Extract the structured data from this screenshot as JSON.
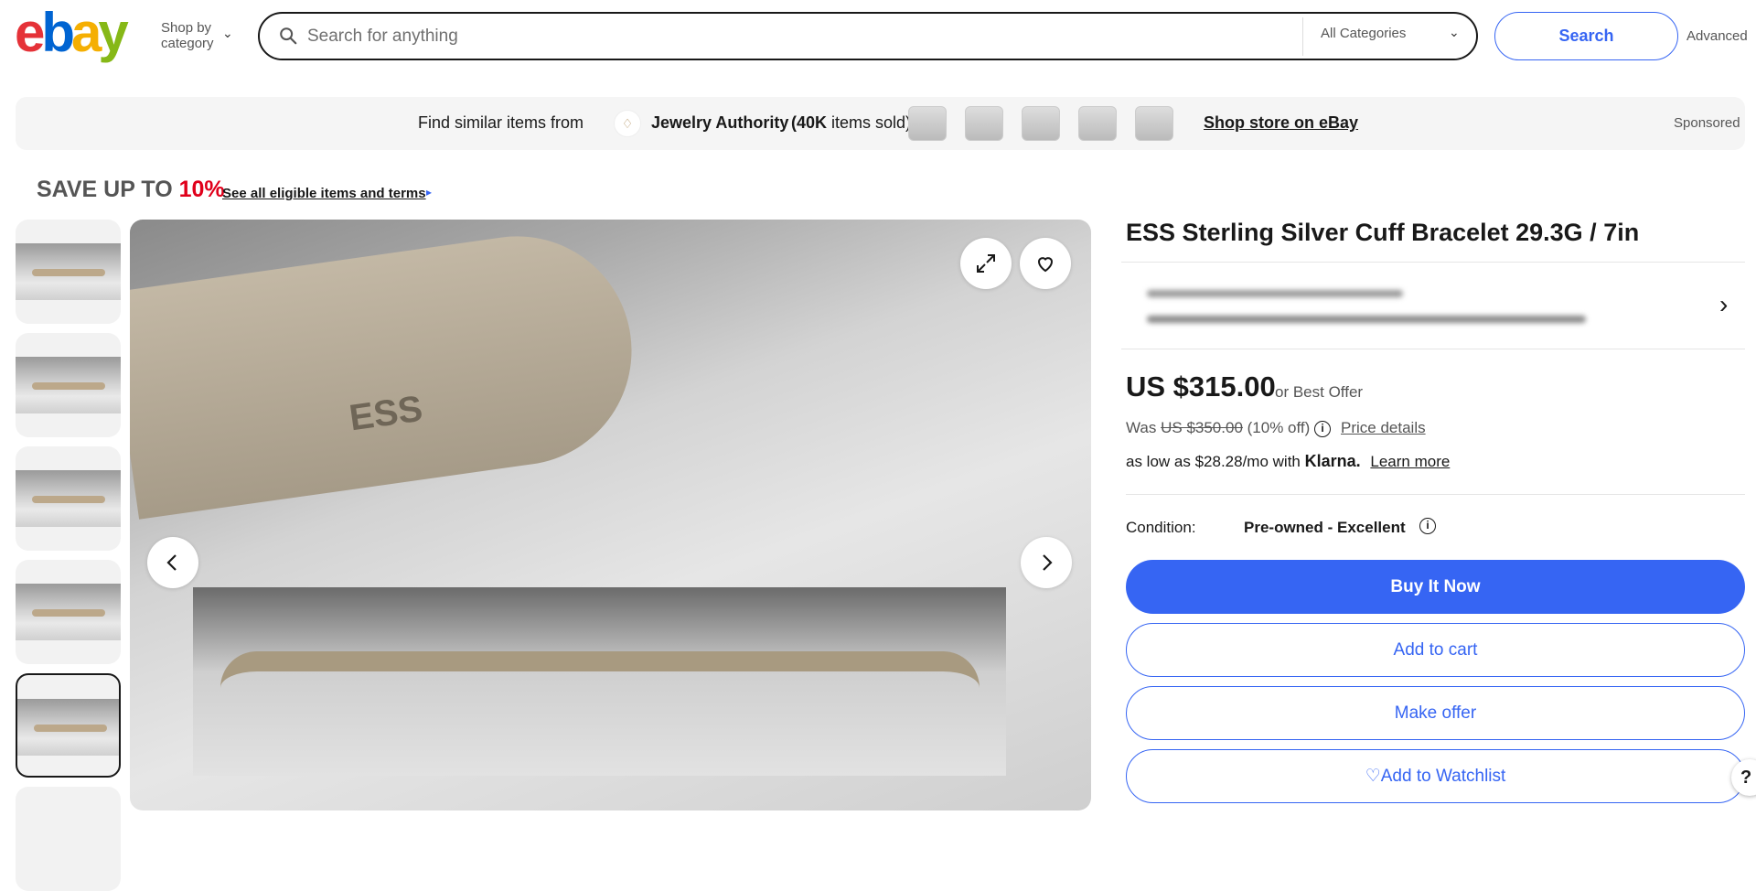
{
  "header": {
    "logo_letters": [
      "e",
      "b",
      "a",
      "y"
    ],
    "shop_by_line1": "Shop by",
    "shop_by_line2": "category",
    "search_placeholder": "Search for anything",
    "category_select": "All Categories",
    "search_button": "Search",
    "advanced_link": "Advanced"
  },
  "promo": {
    "find_text": "Find similar items from",
    "store_name": "Jewelry Authority",
    "sold_count": "(40K",
    "sold_suffix": "items sold)",
    "shop_store_link": "Shop store on eBay",
    "sponsored": "Sponsored"
  },
  "savings": {
    "prefix": "SAVE UP TO ",
    "percent": "10%",
    "link": "See all eligible items and terms"
  },
  "item": {
    "title": "ESS Sterling Silver Cuff Bracelet 29.3G / 7in",
    "price": "US $315.00",
    "best_offer": "or Best Offer",
    "was_label": "Was",
    "was_price": "US $350.00",
    "discount": "(10% off)",
    "price_details": "Price details",
    "klarna_text": "as low as $28.28/mo with",
    "klarna_brand": "Klarna.",
    "klarna_learn_more": "Learn more",
    "condition_label": "Condition:",
    "condition_value": "Pre-owned - Excellent",
    "stamp_text": "ESS"
  },
  "actions": {
    "buy_now": "Buy It Now",
    "add_to_cart": "Add to cart",
    "make_offer": "Make offer",
    "add_to_watchlist": "Add to Watchlist"
  },
  "help": "?",
  "colors": {
    "accent": "#3665f3",
    "red": "#e0001b",
    "ebay_e": "#e53238",
    "ebay_b": "#0064d2",
    "ebay_a": "#f5af02",
    "ebay_y": "#86b817"
  }
}
